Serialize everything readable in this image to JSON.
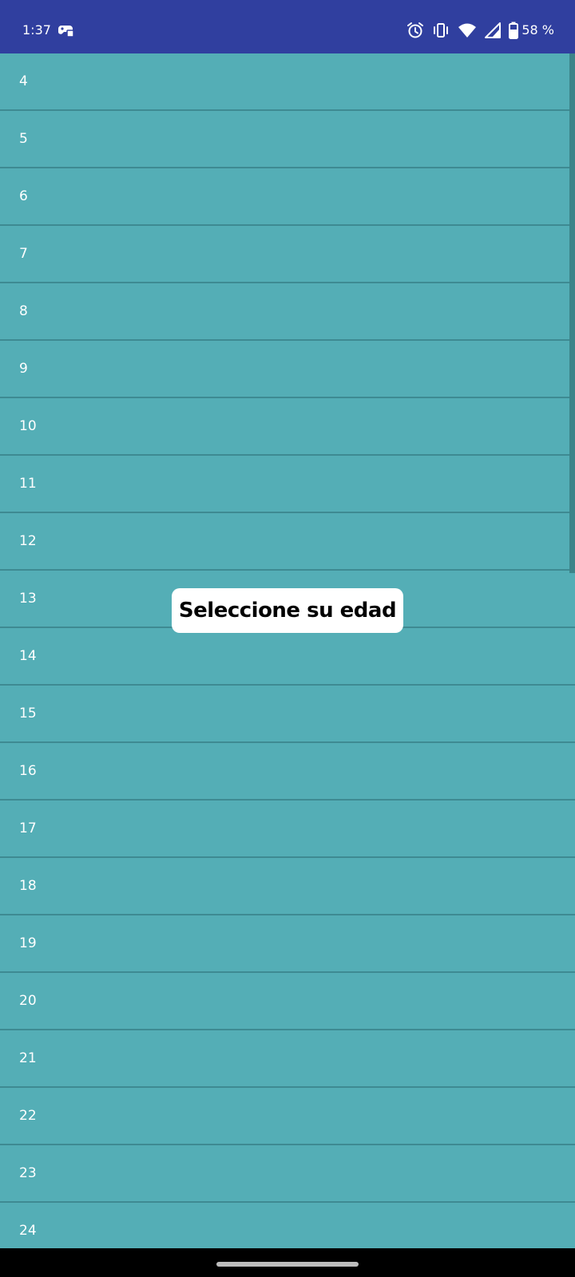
{
  "status_bar": {
    "time": "1:37",
    "left_icon": "game-controller-icon",
    "icons": [
      "alarm-icon",
      "vibrate-icon",
      "wifi-icon",
      "signal-icon",
      "battery-icon"
    ],
    "battery": "58 %",
    "background": "#303F9F"
  },
  "age_list": {
    "background": "#54AEB6",
    "items": [
      "4",
      "5",
      "6",
      "7",
      "8",
      "9",
      "10",
      "11",
      "12",
      "13",
      "14",
      "15",
      "16",
      "17",
      "18",
      "19",
      "20",
      "21",
      "22",
      "23",
      "24"
    ]
  },
  "toast": {
    "message": "Seleccione su edad"
  }
}
